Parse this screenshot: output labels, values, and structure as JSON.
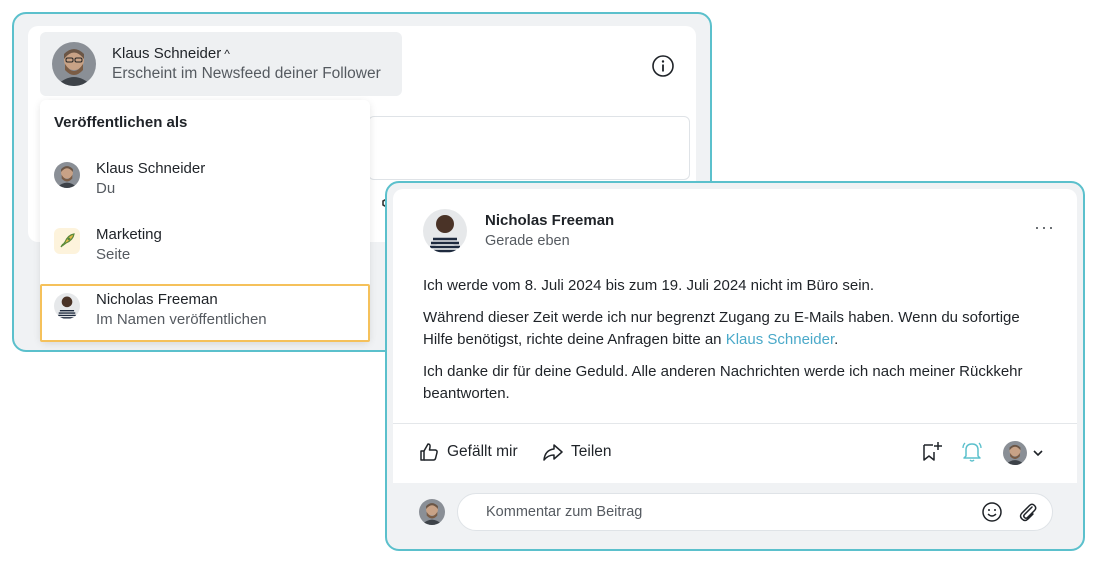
{
  "composer": {
    "author_name": "Klaus Schneider",
    "author_caret": "^",
    "author_subtitle": "Erscheint im Newsfeed deiner Follower",
    "info_icon": "info-circle-icon",
    "megaphone_icon": "megaphone-icon"
  },
  "publish_as": {
    "heading": "Veröffentlichen als",
    "options": [
      {
        "name": "Klaus Schneider",
        "subtitle": "Du"
      },
      {
        "name": "Marketing",
        "subtitle": "Seite"
      },
      {
        "name": "Nicholas Freeman",
        "subtitle": "Im Namen veröffentlichen",
        "selected": true
      }
    ],
    "selected_border_color": "#f5c15b"
  },
  "post": {
    "author_name": "Nicholas Freeman",
    "timestamp": "Gerade eben",
    "more_label": "···",
    "para1": "Ich werde vom 8. Juli 2024 bis zum 19. Juli 2024 nicht im Büro sein.",
    "para2_before": "Während dieser Zeit werde ich nur begrenzt Zugang zu E-Mails haben. Wenn du sofortige Hilfe benötigst, richte deine Anfragen bitte an ",
    "para2_link": "Klaus Schneider",
    "para2_after": ".",
    "para3": "Ich danke dir für deine Geduld. Alle anderen Nachrichten werde ich nach meiner Rückkehr beantworten.",
    "link_color": "#4aa9c9"
  },
  "actions": {
    "like_label": "Gefällt mir",
    "share_label": "Teilen"
  },
  "comment": {
    "placeholder": "Kommentar zum Beitrag"
  },
  "colors": {
    "card_border": "#5bc0cc",
    "bell_accent": "#5bc0cc"
  }
}
